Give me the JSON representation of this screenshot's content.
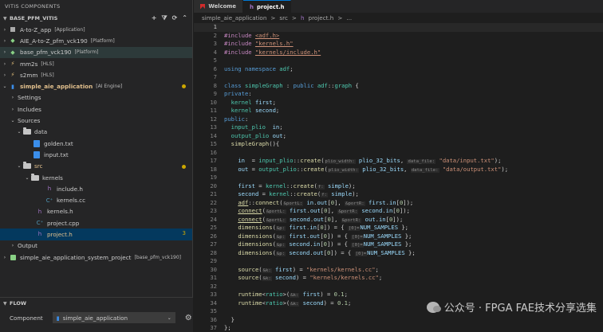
{
  "sidebar": {
    "title": "VITIS COMPONENTS",
    "section_title": "BASE_PFM_VITIS",
    "actions": [
      "+",
      "⧩",
      "⟳",
      "⌃"
    ],
    "items": [
      {
        "label": "A-to-Z_app",
        "tag": "[Application]"
      },
      {
        "label": "AIE_A-to-Z_pfm_vck190",
        "tag": "[Platform]"
      },
      {
        "label": "base_pfm_vck190",
        "tag": "[Platform]"
      },
      {
        "label": "mm2s",
        "tag": "[HLS]"
      },
      {
        "label": "s2mm",
        "tag": "[HLS]"
      },
      {
        "label": "simple_aie_application",
        "tag": "[AI Engine]"
      },
      {
        "label": "Settings"
      },
      {
        "label": "Includes"
      },
      {
        "label": "Sources"
      },
      {
        "label": "data"
      },
      {
        "label": "golden.txt"
      },
      {
        "label": "input.txt"
      },
      {
        "label": "src"
      },
      {
        "label": "kernels"
      },
      {
        "label": "include.h"
      },
      {
        "label": "kernels.cc"
      },
      {
        "label": "kernels.h"
      },
      {
        "label": "project.cpp"
      },
      {
        "label": "project.h",
        "badge": "3"
      },
      {
        "label": "Output"
      },
      {
        "label": "simple_aie_application_system_project",
        "tag": "[base_pfm_vck190]"
      }
    ]
  },
  "flow": {
    "title": "FLOW",
    "component_label": "Component",
    "component_value": "simple_aie_application"
  },
  "tabs": [
    {
      "label": "Welcome"
    },
    {
      "label": "project.h"
    }
  ],
  "breadcrumb": [
    "simple_aie_application",
    ">",
    "src",
    ">",
    "project.h",
    ">",
    "..."
  ],
  "watermark": "公众号 · FPGA FAE技术分享选集"
}
